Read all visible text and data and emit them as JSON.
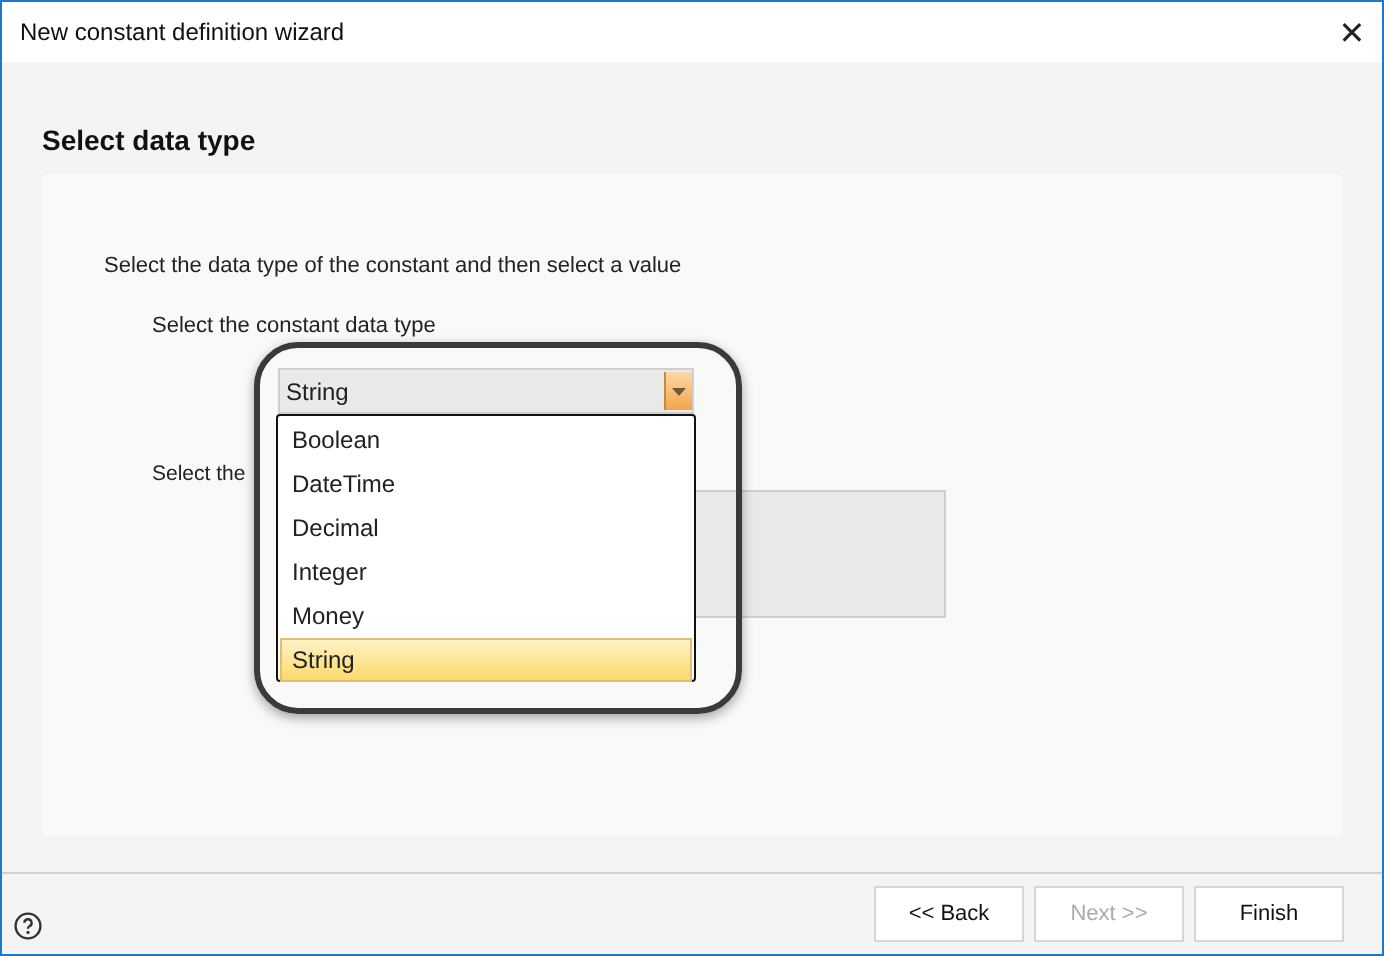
{
  "window": {
    "title": "New constant definition wizard",
    "close": "✕"
  },
  "page": {
    "heading": "Select data type",
    "instruction": "Select the data type of the constant and then select a value",
    "type_label": "Select the constant data type",
    "value_label": "Select the"
  },
  "combo": {
    "value": "String",
    "expanded": true,
    "options": [
      {
        "label": "Boolean",
        "selected": false
      },
      {
        "label": "DateTime",
        "selected": false
      },
      {
        "label": "Decimal",
        "selected": false
      },
      {
        "label": "Integer",
        "selected": false
      },
      {
        "label": "Money",
        "selected": false
      },
      {
        "label": "String",
        "selected": true
      }
    ]
  },
  "buttons": [
    {
      "label": "<< Back",
      "disabled": false
    },
    {
      "label": "Next >>",
      "disabled": true
    },
    {
      "label": "Finish",
      "disabled": false
    }
  ]
}
